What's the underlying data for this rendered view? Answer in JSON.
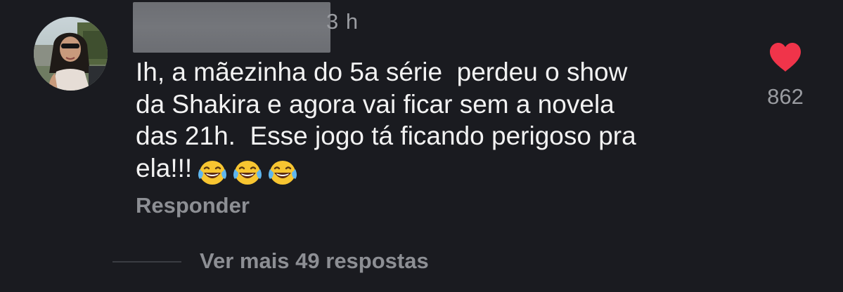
{
  "comment": {
    "timestamp": "3 h",
    "text": "Ih, a mãezinha do 5a série  perdeu o show\nda Shakira e agora vai ficar sem a novela\ndas 21h.  Esse jogo tá ficando perigoso pra\nela!!!",
    "emojis": [
      "face-with-tears-of-joy-icon",
      "face-with-tears-of-joy-icon",
      "face-with-tears-of-joy-icon"
    ],
    "reply_label": "Responder",
    "like_count": "862",
    "like_color": "#f0344a",
    "more_replies_label": "Ver mais 49 respostas"
  },
  "colors": {
    "background": "#1a1b20",
    "text_primary": "#f2f2f2",
    "text_secondary": "#8d8f94",
    "heart": "#f0344a",
    "redaction": "#6f7176"
  }
}
